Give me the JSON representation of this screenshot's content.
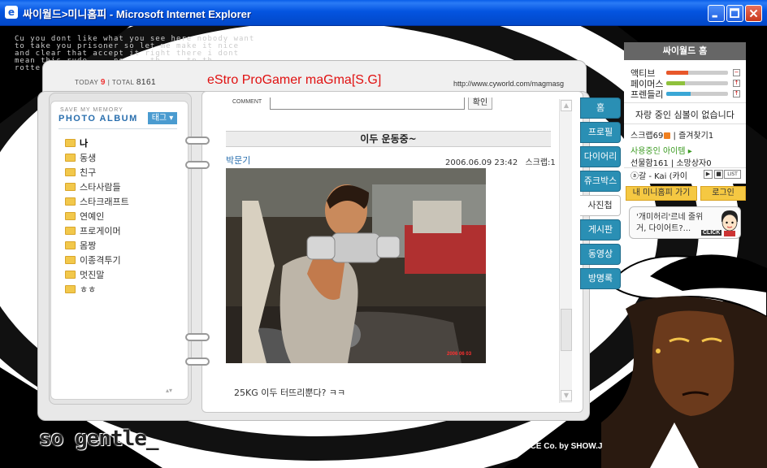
{
  "window": {
    "title": "싸이월드>미니홈피 - Microsoft Internet Explorer",
    "icon": "ie-icon"
  },
  "background": {
    "scribble": "Cu you dont like what you see   here nobody want to take you prisoner so let me make it nice and clear that accept it right there i dont mean this rude ... no ... th ... tp th ... rotte",
    "brand": "so gentle_",
    "credit": "©GRAFFICE Co. by SHOW.J"
  },
  "header": {
    "today_label": "TODAY",
    "today_value": "9",
    "separator": "|",
    "total_label": "TOTAL",
    "total_value": "8161",
    "home_title": "eStro ProGamer maGma[S.G]",
    "url": "http://www.cyworld.com/magmasg"
  },
  "album": {
    "subtitle": "SAVE MY MEMORY",
    "title": "PHOTO ALBUM",
    "tag_button": "태그 ▾",
    "folders": [
      "나",
      "동생",
      "친구",
      "스타사람들",
      "스타크래프트",
      "연예인",
      "프로게이머",
      "몸짱",
      "이종격투기",
      "멋진말",
      "ㅎㅎ"
    ],
    "selected_index": 0
  },
  "post": {
    "comment_label": "COMMENT",
    "comment_value": "",
    "confirm_button": "확인",
    "title": "이두 운동중~",
    "author": "박문기",
    "datetime": "2006.06.09 23:42",
    "scrap": "스크랩:1",
    "photo_stamp": "2006 06 03",
    "caption": "25KG 이두 터뜨리뿐다? ㅋㅋ"
  },
  "tabs": [
    {
      "label": "홈",
      "active": false
    },
    {
      "label": "프로필",
      "active": false
    },
    {
      "label": "다이어리",
      "active": false
    },
    {
      "label": "쥬크박스",
      "active": false
    },
    {
      "label": "사진첩",
      "active": true
    },
    {
      "label": "게시판",
      "active": false
    },
    {
      "label": "동영상",
      "active": false
    },
    {
      "label": "방명록",
      "active": false
    }
  ],
  "sidebar": {
    "title": "싸이월드 홈",
    "stats": [
      {
        "label": "액티브",
        "level": 0.35,
        "color": "#e8572a",
        "control": "−"
      },
      {
        "label": "페이머스",
        "level": 0.3,
        "color": "#8fc13c",
        "control": "↑"
      },
      {
        "label": "프렌들리",
        "level": 0.4,
        "color": "#3aa7d6",
        "control": "↑"
      }
    ],
    "message": "자랑 중인 심볼이 없습니다",
    "scrap_line": "스크랩69",
    "favorite": "| 즐겨찾기1",
    "items_in_use": "사용중인 아이템 ▸",
    "gift_line": "선물함161  |  소망상자0",
    "music_line": "ⓐ갈 - Kai (카이",
    "list_label": "LIST",
    "go_my_home": "내 미니홈피 가기",
    "login": "로그인",
    "speech_text": "'개미허리'르네 줄위 거, 다이어트?...",
    "speech_click": "CLICK"
  }
}
